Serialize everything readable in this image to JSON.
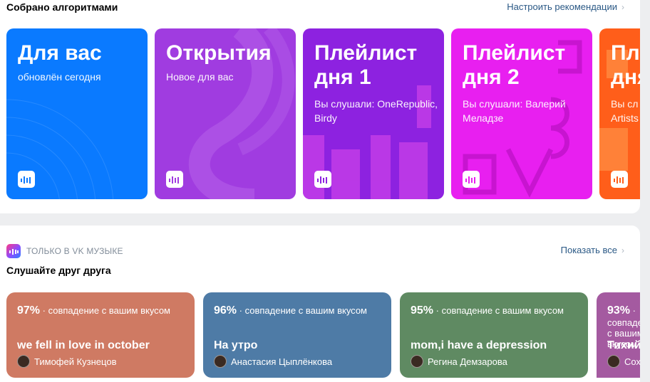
{
  "algorithms": {
    "title": "Собрано алгоритмами",
    "link": "Настроить рекомендации",
    "cards": [
      {
        "title": "Для вас",
        "subtitle": "обновлён сегодня",
        "color": "#0a7aff"
      },
      {
        "title": "Открытия",
        "subtitle": "Новое для вас",
        "color": "#a03ce0"
      },
      {
        "title": "Плейлист дня 1",
        "subtitle": "Вы слушали: OneRepublic, Birdy",
        "color": "#8d22e0"
      },
      {
        "title": "Плейлист дня 2",
        "subtitle": "Вы слушали: Валерий Меладзе",
        "color": "#e81ff0"
      },
      {
        "title": "Пл дня",
        "subtitle": "Вы сл Artists",
        "color": "#ff5e1a"
      }
    ]
  },
  "together": {
    "badge": "ТОЛЬКО В VK МУЗЫКЕ",
    "title": "Слушайте друг друга",
    "link": "Показать все",
    "match_suffix": "· совпадение с вашим вкусом",
    "cards": [
      {
        "percent": "97%",
        "playlist": "we fell in love in october",
        "user": "Тимофей Кузнецов",
        "color": "#cf7a63"
      },
      {
        "percent": "96%",
        "playlist": "На утро",
        "user": "Анастасия Цыплёнкова",
        "color": "#4e7ba6"
      },
      {
        "percent": "95%",
        "playlist": "mom,i have a depression",
        "user": "Регина Демзарова",
        "color": "#5f8a62"
      },
      {
        "percent": "93%",
        "playlist": "Тихий",
        "user": "Сох",
        "color": "#a45aa0"
      }
    ]
  },
  "icons": {
    "chevron": "chevron-right-icon",
    "vk_music": "vk-music-icon",
    "card_logo": "music-wave-icon"
  }
}
